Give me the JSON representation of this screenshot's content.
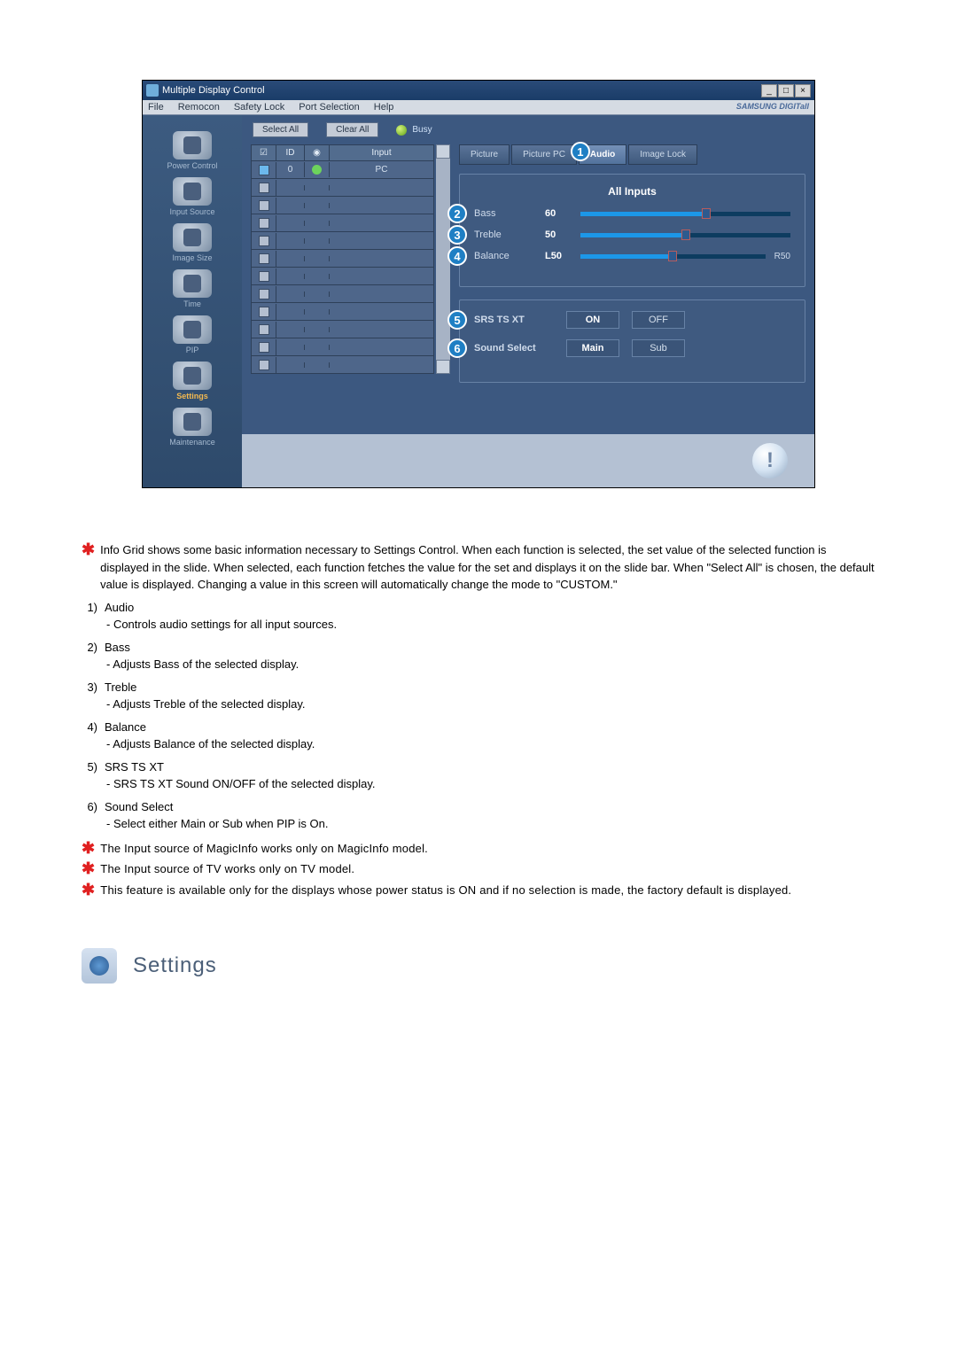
{
  "window": {
    "title": "Multiple Display Control",
    "min": "_",
    "max": "□",
    "close": "×"
  },
  "menubar": {
    "items": [
      "File",
      "Remocon",
      "Safety Lock",
      "Port Selection",
      "Help"
    ],
    "brand": "SAMSUNG DIGITall"
  },
  "sidebar": {
    "items": [
      {
        "label": "Power Control"
      },
      {
        "label": "Input Source"
      },
      {
        "label": "Image Size"
      },
      {
        "label": "Time"
      },
      {
        "label": "PIP"
      },
      {
        "label": "Settings",
        "selected": true
      },
      {
        "label": "Maintenance"
      }
    ]
  },
  "toolbar": {
    "select_all": "Select All",
    "clear_all": "Clear All",
    "busy": "Busy"
  },
  "grid": {
    "headers": {
      "chk": "☑",
      "id": "ID",
      "status": "◉",
      "input": "Input"
    },
    "rows": [
      {
        "id": "0",
        "input": "PC",
        "selected": true,
        "status": true
      },
      {
        "id": "",
        "input": ""
      },
      {
        "id": "",
        "input": ""
      },
      {
        "id": "",
        "input": ""
      },
      {
        "id": "",
        "input": ""
      },
      {
        "id": "",
        "input": ""
      },
      {
        "id": "",
        "input": ""
      },
      {
        "id": "",
        "input": ""
      },
      {
        "id": "",
        "input": ""
      },
      {
        "id": "",
        "input": ""
      },
      {
        "id": "",
        "input": ""
      },
      {
        "id": "",
        "input": ""
      }
    ]
  },
  "tabs": {
    "picture": "Picture",
    "picture_pc": "Picture PC",
    "audio": "Audio",
    "image_lock": "Image Lock",
    "active_callout": "1"
  },
  "audio_panel": {
    "header": "All Inputs",
    "bass": {
      "num": "2",
      "label": "Bass",
      "value": "60",
      "pct": "60%"
    },
    "treble": {
      "num": "3",
      "label": "Treble",
      "value": "50",
      "pct": "50%"
    },
    "balance": {
      "num": "4",
      "label": "Balance",
      "left": "L50",
      "right": "R50",
      "pct": "50%"
    }
  },
  "toggle_panel": {
    "srs": {
      "num": "5",
      "label": "SRS TS XT",
      "on": "ON",
      "off": "OFF"
    },
    "sound_select": {
      "num": "6",
      "label": "Sound Select",
      "main": "Main",
      "sub": "Sub"
    }
  },
  "footer_alert": "!",
  "doc": {
    "intro": "Info Grid shows some basic information necessary to Settings Control. When each function is selected, the set value of the selected function is displayed in the slide. When selected, each function fetches the value for the set and displays it on the slide bar. When \"Select All\" is chosen, the default value is displayed. Changing a value in this screen will automatically change the mode to \"CUSTOM.\"",
    "items": [
      {
        "n": "1)",
        "title": "Audio",
        "desc": "- Controls audio settings for all input sources."
      },
      {
        "n": "2)",
        "title": "Bass",
        "desc": "- Adjusts Bass of the selected display."
      },
      {
        "n": "3)",
        "title": "Treble",
        "desc": "- Adjusts Treble of the selected display."
      },
      {
        "n": "4)",
        "title": "Balance",
        "desc": "- Adjusts Balance of the selected display."
      },
      {
        "n": "5)",
        "title": "SRS TS XT",
        "desc": "- SRS TS XT Sound ON/OFF of the selected display."
      },
      {
        "n": "6)",
        "title": "Sound Select",
        "desc": "- Select either Main or Sub when PIP is On."
      }
    ],
    "note1": "The Input source of MagicInfo works only on MagicInfo model.",
    "note2": "The Input source of TV works only on TV model.",
    "note3": "This feature is available only for the displays whose power status is ON and if no selection is made, the factory default is displayed."
  },
  "settings_heading": "Settings"
}
